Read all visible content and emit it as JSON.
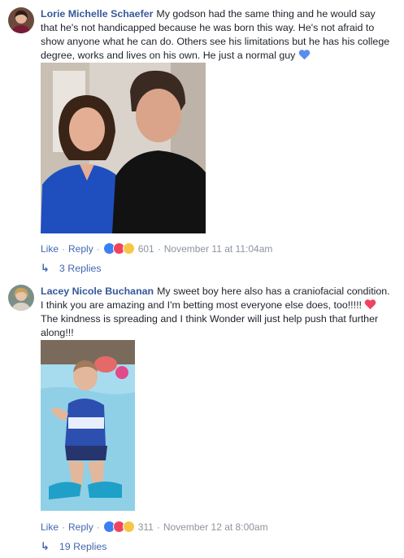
{
  "comments": [
    {
      "author": "Lorie Michelle Schaefer",
      "text": "My godson had the same thing and he would say that he's not handicapped because he was born this way. He's not afraid to show anyone what he can do. Others see his limitations but he has his college degree, works and lives on his own. He just a normal guy",
      "emoji": "blue-heart",
      "actions": {
        "like": "Like",
        "reply": "Reply",
        "reaction_count": "601",
        "timestamp": "November 11 at 11:04am"
      },
      "replies_label": "3 Replies",
      "reactions": [
        "like",
        "love",
        "wow"
      ]
    },
    {
      "author": "Lacey Nicole Buchanan",
      "text_before": "My sweet boy here also has a craniofacial condition. I think you are amazing and I'm betting most everyone else does, too!!!!!",
      "text_after": "The kindness is spreading and I think Wonder will just help push that further along!!!",
      "emoji": "red-heart",
      "actions": {
        "like": "Like",
        "reply": "Reply",
        "reaction_count": "311",
        "timestamp": "November 12 at 8:00am"
      },
      "replies_label": "19 Replies",
      "reactions": [
        "like",
        "love",
        "haha"
      ]
    }
  ],
  "colors": {
    "author": "#365899",
    "link": "#4267b2",
    "meta": "#8d949e",
    "like": "#3b7ff2",
    "love": "#f0435f",
    "wow": "#f7c646"
  }
}
